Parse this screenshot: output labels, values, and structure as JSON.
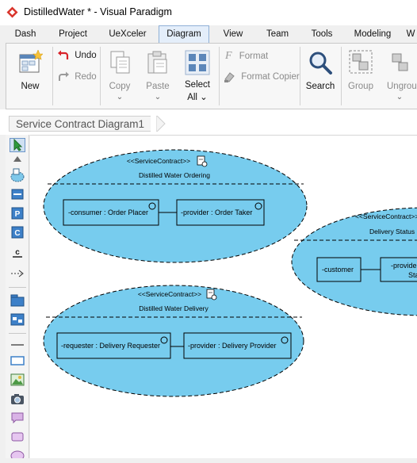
{
  "window": {
    "title": "DistilledWater * - Visual Paradigm",
    "brand_color": "#d9342b"
  },
  "menu": {
    "tabs": [
      "Dash",
      "Project",
      "UeXceler",
      "Diagram",
      "View",
      "Team",
      "Tools",
      "Modeling",
      "W"
    ],
    "active": "Diagram"
  },
  "ribbon": {
    "new_label": "New",
    "undo_label": "Undo",
    "redo_label": "Redo",
    "copy_label": "Copy",
    "paste_label": "Paste",
    "select_all_label": "Select All",
    "select_label_1": "Select",
    "select_label_2": "All",
    "format_label": "Format",
    "format_copier_label": "Format Copier",
    "search_label": "Search",
    "group_label": "Group",
    "ungroup_label": "Ungroup",
    "icons": [
      "new-icon",
      "undo-icon",
      "redo-icon",
      "copy-icon",
      "paste-icon",
      "select-all-icon",
      "format-icon",
      "format-copier-icon",
      "search-icon",
      "group-icon",
      "ungroup-icon"
    ]
  },
  "breadcrumb": {
    "diagram_name": "Service Contract Diagram1"
  },
  "toolbox": {
    "tools": [
      "selector-icon",
      "triangle-up-icon",
      "service-contract-icon",
      "component-icon",
      "participant-p-icon",
      "participant-c-icon",
      "underline-c-icon",
      "dashed-arrow-icon",
      "package-icon",
      "structured-class-icon",
      "line-icon",
      "rectangle-icon",
      "image-icon",
      "camera-icon",
      "comment-icon",
      "note-icon",
      "ellipse-icon"
    ]
  },
  "diagram": {
    "accent": "#77ccee",
    "contracts": [
      {
        "stereotype": "<<ServiceContract>>",
        "name": "Distilled Water Ordering",
        "roles": [
          "-consumer : Order Placer",
          "-provider : Order Taker"
        ]
      },
      {
        "stereotype": "<<ServiceContract>>",
        "name": "Delivery Status",
        "roles": [
          "-customer",
          "-provider",
          "Sta"
        ]
      },
      {
        "stereotype": "<<ServiceContract>>",
        "name": "Distilled Water Delivery",
        "roles": [
          "-requester : Delivery Requester",
          "-provider : Delivery Provider"
        ]
      }
    ]
  }
}
